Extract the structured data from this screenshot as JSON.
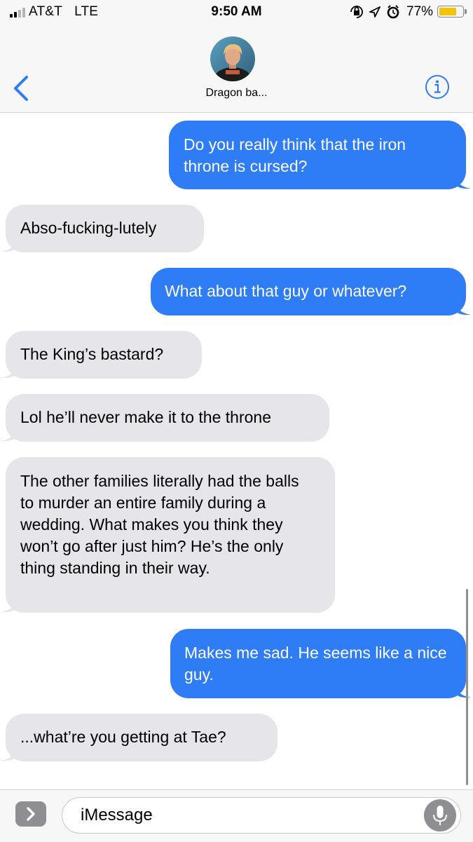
{
  "status_bar": {
    "carrier": "AT&T",
    "network": "LTE",
    "time": "9:50 AM",
    "battery_percent": "77%",
    "battery_level": 0.77,
    "icons": [
      "rotation-lock-icon",
      "location-arrow-icon",
      "alarm-icon"
    ]
  },
  "header": {
    "contact_name": "Dragon ba...",
    "back_icon": "chevron-left-icon",
    "info_icon": "info-icon"
  },
  "messages": [
    {
      "direction": "outgoing",
      "text": "Do you really think that the iron throne is cursed?"
    },
    {
      "direction": "incoming",
      "text": "Abso-fucking-lutely"
    },
    {
      "direction": "outgoing",
      "text": "What about that guy or whatever?"
    },
    {
      "direction": "incoming",
      "text": "The King’s bastard?"
    },
    {
      "direction": "incoming",
      "text": "Lol he’ll never make it to the throne"
    },
    {
      "direction": "incoming",
      "text": "The other families literally had the balls to murder an entire family during a wedding. What makes you think they won’t go after just him? He’s the only thing standing in their way."
    },
    {
      "direction": "outgoing",
      "text": "Makes me sad. He seems like a nice guy."
    },
    {
      "direction": "incoming",
      "text": "...what’re you getting at Tae?"
    }
  ],
  "input": {
    "placeholder": "iMessage",
    "apps_icon": "chevron-right-icon",
    "mic_icon": "microphone-icon"
  },
  "colors": {
    "outgoing_bubble": "#2e7cf6",
    "incoming_bubble": "#e5e5ea",
    "accent": "#2e7cf6",
    "battery": "#f5c400"
  }
}
